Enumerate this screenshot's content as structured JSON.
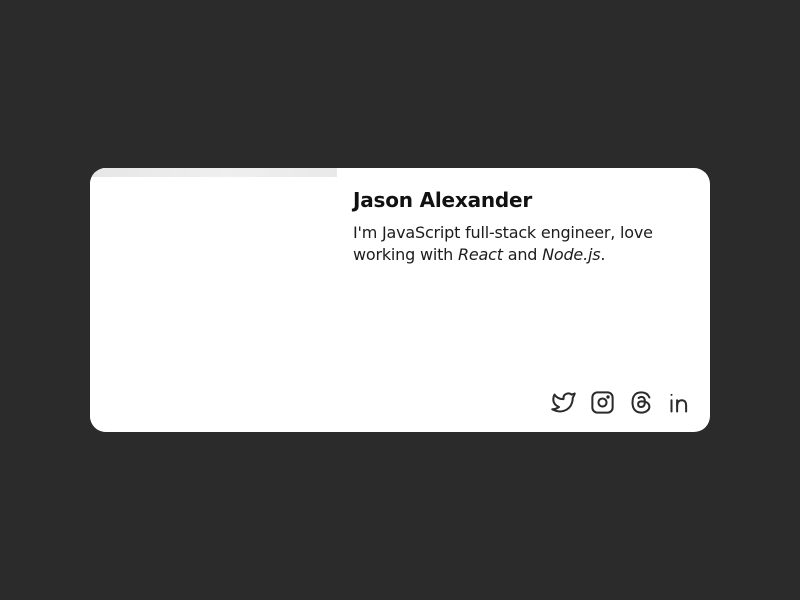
{
  "card": {
    "name": "Jason Alexander",
    "bio": {
      "prefix": "I'm JavaScript full-stack engineer, love working with ",
      "tech1": "React",
      "middle": " and ",
      "tech2": "Node.js",
      "suffix": "."
    },
    "socials": [
      {
        "name": "twitter",
        "icon": "twitter-icon"
      },
      {
        "name": "instagram",
        "icon": "instagram-icon"
      },
      {
        "name": "threads",
        "icon": "threads-icon"
      },
      {
        "name": "linkedin",
        "icon": "linkedin-icon"
      }
    ]
  },
  "colors": {
    "background": "#2b2b2b",
    "card": "#ffffff",
    "text": "#111111",
    "icon": "#2a2a2a"
  }
}
